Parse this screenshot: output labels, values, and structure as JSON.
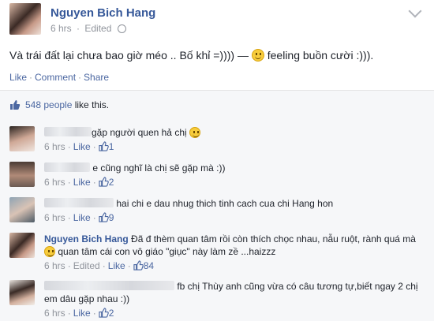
{
  "post": {
    "author": "Nguyen Bich Hang",
    "time": "6 hrs",
    "edited": "Edited",
    "text_before": "Và trái đất lại chưa bao giờ méo .. Bố khỉ =)))) —",
    "text_after": "feeling buồn cười :))).",
    "actions": {
      "like": "Like",
      "comment": "Comment",
      "share": "Share"
    }
  },
  "likes": {
    "count": "548 people",
    "suffix": " like this."
  },
  "comments": [
    {
      "name": "",
      "text": "gặp người quen hả chị",
      "has_emoji": true,
      "time": "6 hrs",
      "like": "Like",
      "likes": "1"
    },
    {
      "name": "",
      "text": "e cũng nghĩ là chị sẽ gặp mà :))",
      "has_emoji": false,
      "time": "6 hrs",
      "like": "Like",
      "likes": "2"
    },
    {
      "name": "",
      "text": "hai chi e dau nhug thich tinh cach cua chi Hang hon",
      "has_emoji": false,
      "time": "6 hrs",
      "like": "Like",
      "likes": "9"
    },
    {
      "name": "Nguyen Bich Hang",
      "text_a": "Đã đ thèm quan tâm rồi còn thích chọc nhau, nẫu ruột, rành quá mà",
      "text_b": "quan tâm cái con vô giáo \"giục\" này làm zề ...haizzz",
      "time": "6 hrs",
      "edited": "Edited",
      "like": "Like",
      "likes": "84"
    },
    {
      "name": "",
      "text": "fb chị Thùy anh cũng vừa có câu tương tự,biết ngay 2 chị em dâu gặp nhau :))",
      "time": "6 hrs",
      "like": "Like",
      "likes": "2"
    }
  ],
  "colors": {
    "link": "#365899",
    "meta": "#90949c",
    "emoji": "#f7cc3c"
  }
}
